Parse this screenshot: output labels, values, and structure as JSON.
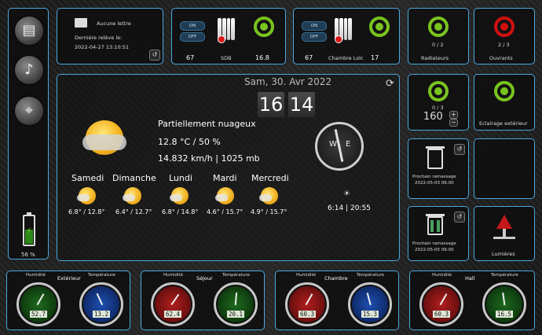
{
  "mail": {
    "title": "Aucune lettre",
    "label": "Dernière relève le:",
    "date": "2022-04-27 13:10:51"
  },
  "rooms": [
    {
      "on": "ON",
      "off": "OFF",
      "setpoint": "67",
      "name": "SDB",
      "temp": "16.8"
    },
    {
      "on": "ON",
      "off": "OFF",
      "setpoint": "67",
      "name": "Chambre Loïc",
      "temp": "17"
    }
  ],
  "tiles": {
    "radiateurs": {
      "count": "0 / 2",
      "label": "Radiateurs"
    },
    "ouvrants": {
      "count": "2 / 3",
      "label": "Ouvrants"
    },
    "eclairage": {
      "count": "0 / 3",
      "value": "160",
      "label": "Eclairage extérieur"
    },
    "ramassage1": {
      "label": "Prochain ramassage",
      "date": "2022-05-03 06:00"
    },
    "ramassage2": {
      "label": "Prochain ramassage",
      "date": "2022-05-05 06:00"
    },
    "lumieres": {
      "label": "Lumières"
    }
  },
  "sidebar": {
    "battery": "56 %"
  },
  "weather": {
    "date": "Sam, 30. Avr 2022",
    "hour": "16",
    "minute": "14",
    "condition": "Partiellement nuageux",
    "temp_hum": "12.8 °C / 50 %",
    "wind_pressure": "14.832 km/h | 1025 mb",
    "sun_times": "6:14 | 20:55",
    "forecast": [
      {
        "day": "Samedi",
        "range": "6.8° / 12.8°"
      },
      {
        "day": "Dimanche",
        "range": "6.4° / 12.7°"
      },
      {
        "day": "Lundi",
        "range": "6.8° / 14.8°"
      },
      {
        "day": "Mardi",
        "range": "4.6° / 15.7°"
      },
      {
        "day": "Mercredi",
        "range": "4.9° / 15.7°"
      }
    ]
  },
  "sensors": [
    {
      "room": "Extérieur",
      "hum_label": "Humidité",
      "temp_label": "Température",
      "hum": "52.7",
      "temp": "13.2",
      "hum_color": "green",
      "temp_color": "blue"
    },
    {
      "room": "Séjour",
      "hum_label": "Humidité",
      "temp_label": "Température",
      "hum": "62.4",
      "temp": "20.1",
      "hum_color": "red",
      "temp_color": "green"
    },
    {
      "room": "Chambre",
      "hum_label": "Humidité",
      "temp_label": "Température",
      "hum": "60.3",
      "temp": "15.3",
      "hum_color": "red",
      "temp_color": "blue"
    },
    {
      "room": "Hall",
      "hum_label": "Humidité",
      "temp_label": "Température",
      "hum": "60.3",
      "temp": "16.5",
      "hum_color": "red",
      "temp_color": "green"
    }
  ],
  "colors": {
    "border": "#4aa8e0",
    "on": "#7ac41f",
    "alert": "#d01010"
  }
}
